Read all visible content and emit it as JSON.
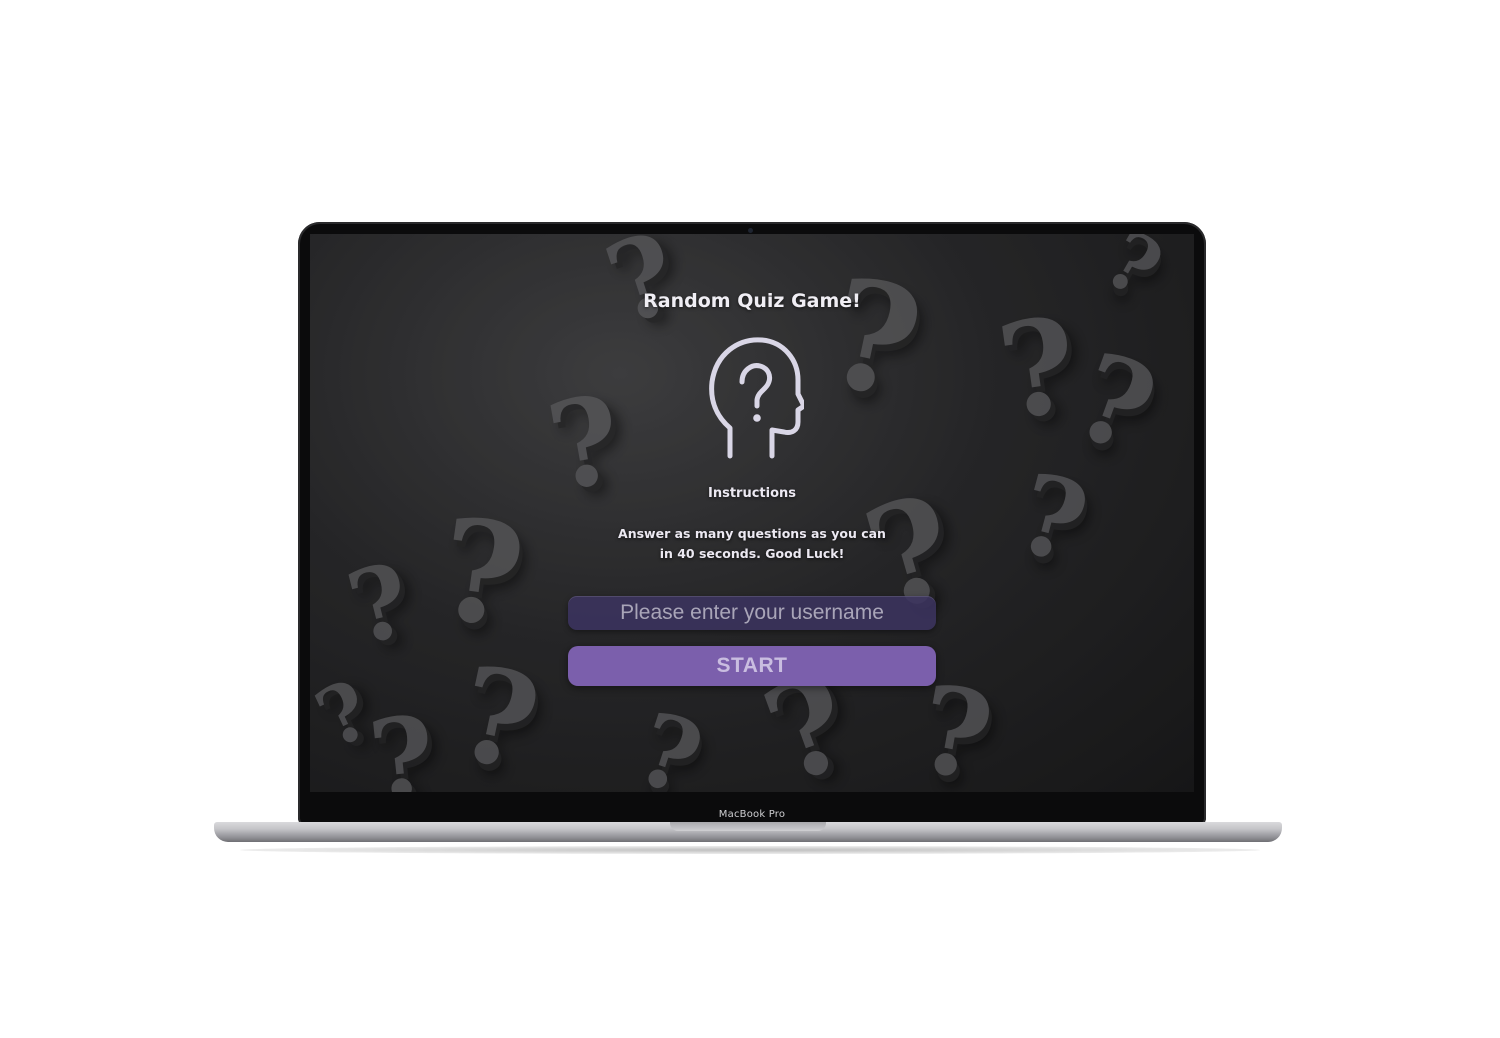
{
  "device": {
    "brand_label": "MacBook Pro"
  },
  "quiz": {
    "title": "Random Quiz Game!",
    "icon": "head-question-icon",
    "instructions_heading": "Instructions",
    "instructions_text": "Answer as many questions as you can in 40 seconds. Good Luck!",
    "username_placeholder": "Please enter your username",
    "username_value": "",
    "start_label": "START"
  },
  "colors": {
    "accent": "#7b5fac",
    "input_bg": "#3c3460",
    "icon_stroke": "#d9d6e6"
  }
}
